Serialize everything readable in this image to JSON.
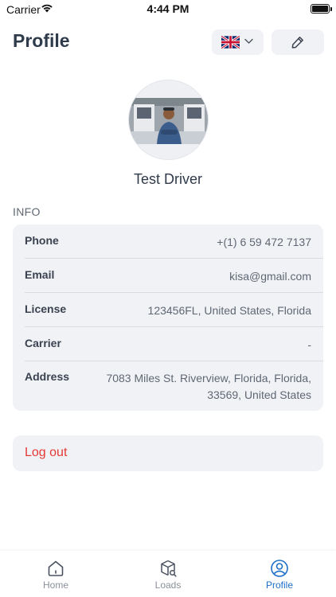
{
  "status_bar": {
    "carrier": "Carrier",
    "time": "4:44 PM"
  },
  "header": {
    "title": "Profile",
    "language_icon": "uk-flag-icon",
    "edit_icon": "pencil-icon"
  },
  "profile": {
    "name": "Test Driver"
  },
  "info": {
    "section_label": "INFO",
    "rows": [
      {
        "label": "Phone",
        "value": "+(1) 6 59 472 7137"
      },
      {
        "label": "Email",
        "value": "kisa@gmail.com"
      },
      {
        "label": "License",
        "value": "123456FL, United States, Florida"
      },
      {
        "label": "Carrier",
        "value": "-"
      },
      {
        "label": "Address",
        "value_line1": "7083 Miles St. Riverview, Florida, Florida,",
        "value_line2": "33569, United States"
      }
    ]
  },
  "logout_label": "Log out",
  "tabs": [
    {
      "label": "Home",
      "icon": "home-icon",
      "active": false
    },
    {
      "label": "Loads",
      "icon": "loads-icon",
      "active": false
    },
    {
      "label": "Profile",
      "icon": "profile-icon",
      "active": true
    }
  ],
  "colors": {
    "accent": "#1e6fc7",
    "danger": "#e53935",
    "card_bg": "#f1f2f6"
  }
}
